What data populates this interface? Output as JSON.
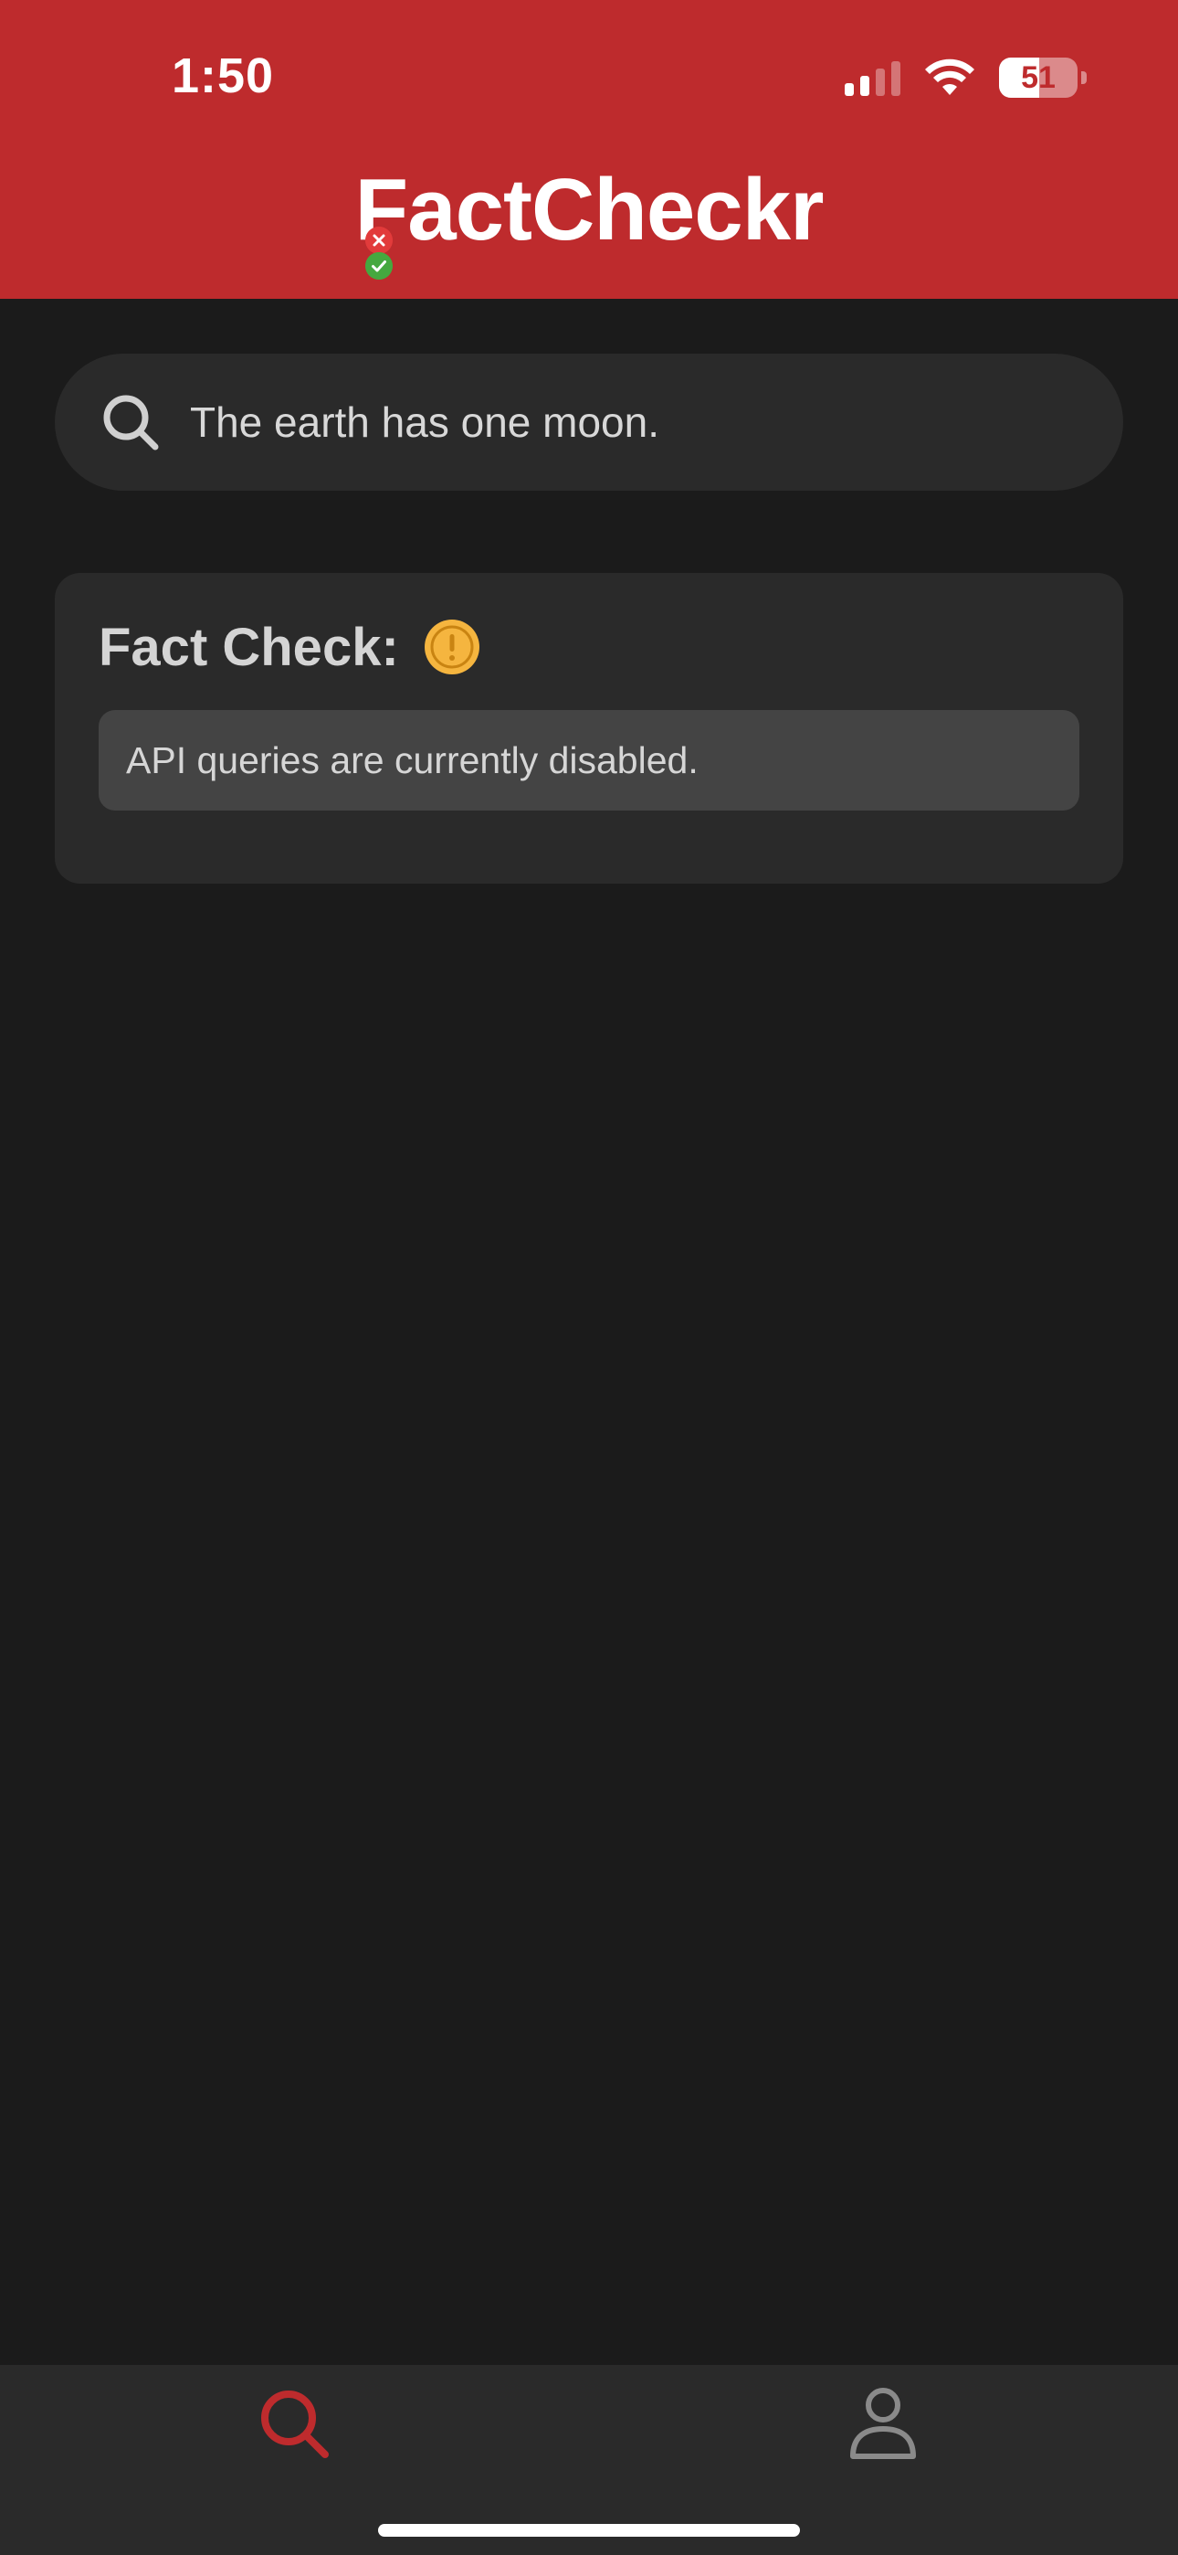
{
  "status_bar": {
    "time": "1:50",
    "battery_percent": "51",
    "signal_bars_active": 2,
    "signal_bars_total": 4
  },
  "header": {
    "app_title": "FactCheckr",
    "background_color": "#be2b2d"
  },
  "search": {
    "query": "The earth has one moon.",
    "icon": "search-icon"
  },
  "result_card": {
    "title": "Fact Check:",
    "status_icon": "warning-icon",
    "status_color": "#f5b53f",
    "message": "API queries are currently disabled."
  },
  "tab_bar": {
    "tabs": [
      {
        "name": "search",
        "icon": "search-icon",
        "active": true,
        "color": "#be2b2d"
      },
      {
        "name": "profile",
        "icon": "person-icon",
        "active": false,
        "color": "#8a8a8a"
      }
    ]
  }
}
